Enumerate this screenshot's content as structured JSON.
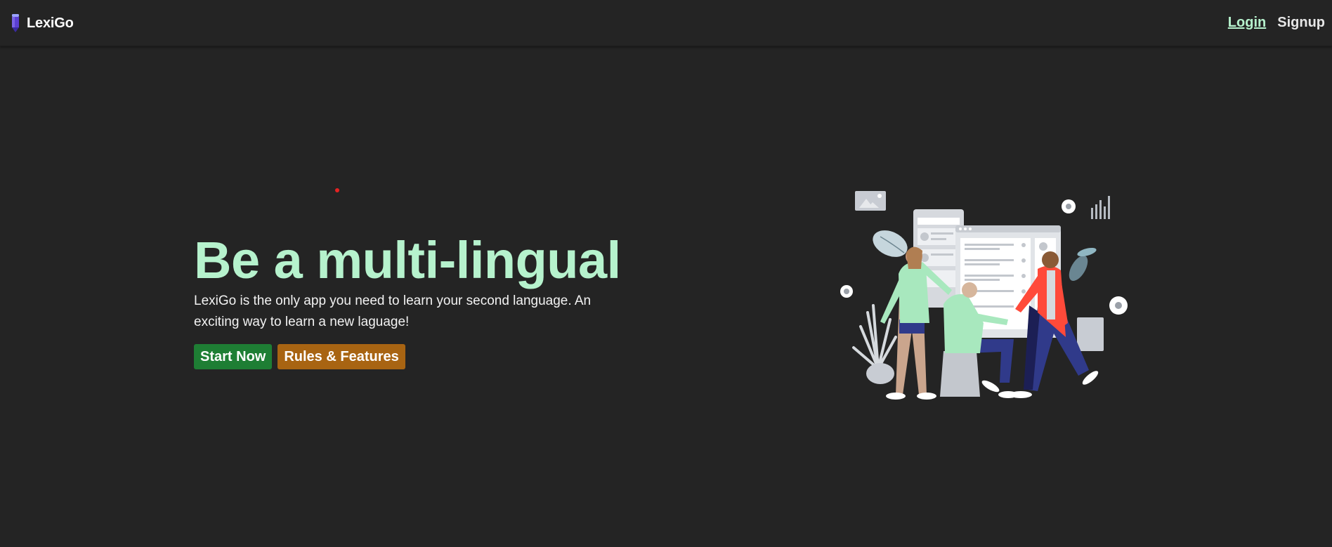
{
  "colors": {
    "background": "#242424",
    "accent_green_text": "#b6f2cd",
    "primary_button": "#1e7e34",
    "secondary_button": "#a86412",
    "logo": "#6a4fd8"
  },
  "navbar": {
    "brand_name": "LexiGo",
    "brand_icon": "pencil-icon",
    "links": {
      "login": "Login",
      "signup": "Signup"
    }
  },
  "hero": {
    "headline": "Be a multi-lingual",
    "description": "LexiGo is the only app you need to learn your second language. An exciting way to learn a new laguage!",
    "buttons": {
      "start": "Start Now",
      "rules": "Rules & Features"
    },
    "illustration": "team-collaboration-illustration"
  }
}
